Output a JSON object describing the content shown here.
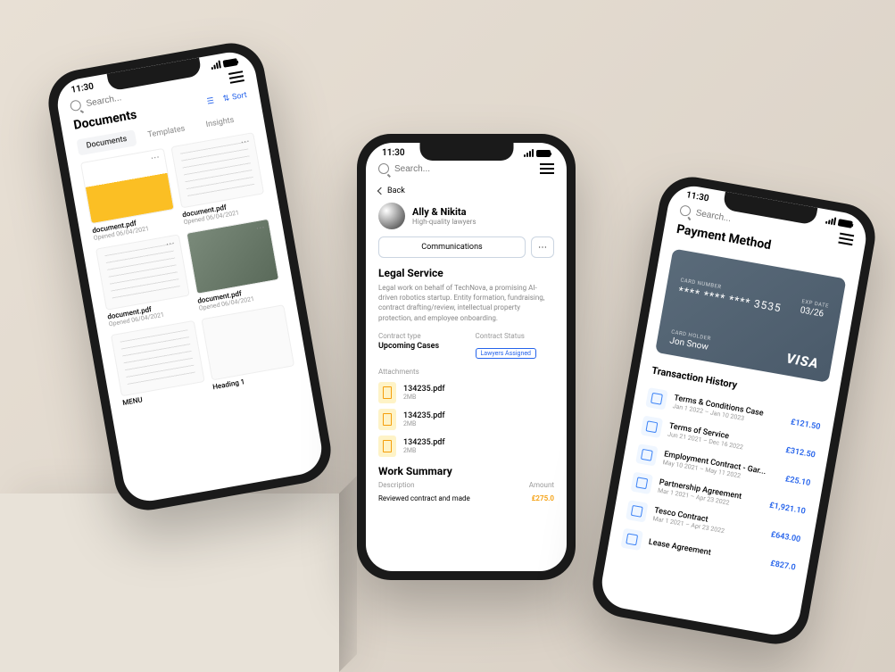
{
  "status": {
    "time": "11:30"
  },
  "search": {
    "placeholder": "Search..."
  },
  "documents": {
    "title": "Documents",
    "sort_label": "Sort",
    "tabs": [
      {
        "label": "Documents"
      },
      {
        "label": "Templates"
      },
      {
        "label": "Insights"
      }
    ],
    "items": [
      {
        "name": "document.pdf",
        "meta": "Opened 06/04/2021"
      },
      {
        "name": "document.pdf",
        "meta": "Opened 06/04/2021"
      },
      {
        "name": "document.pdf",
        "meta": "Opened 06/04/2021"
      },
      {
        "name": "document.pdf",
        "meta": "Opened 06/04/2021"
      },
      {
        "name": "MENU",
        "meta": ""
      },
      {
        "name": "Heading 1",
        "meta": ""
      }
    ]
  },
  "legal": {
    "back": "Back",
    "profile_name": "Ally & Nikita",
    "profile_sub": "High-quality lawyers",
    "comm_btn": "Communications",
    "section_title": "Legal Service",
    "desc": "Legal work on behalf of TechNova, a promising AI-driven robotics startup. Entity formation, fundraising, contract drafting/review, intellectual property protection, and employee onboarding.",
    "contract_type_label": "Contract type",
    "contract_type": "Upcoming Cases",
    "contract_status_label": "Contract Status",
    "contract_status": "Lawyers Assigned",
    "attachments_label": "Attachments",
    "attachments": [
      {
        "name": "134235.pdf",
        "size": "2MB"
      },
      {
        "name": "134235.pdf",
        "size": "2MB"
      },
      {
        "name": "134235.pdf",
        "size": "2MB"
      }
    ],
    "summary_title": "Work Summary",
    "summary_desc": "Description",
    "summary_amt": "Amount",
    "summary_row_desc": "Reviewed contract and made",
    "summary_row_amt": "£275.0"
  },
  "payment": {
    "title": "Payment Method",
    "card_number_label": "CARD NUMBER",
    "card_number": "**** **** **** 3535",
    "exp_label": "EXP DATE",
    "exp": "03/26",
    "holder_label": "CARD HOLDER",
    "holder": "Jon Snow",
    "brand": "VISA",
    "tx_title": "Transaction History",
    "tx": [
      {
        "name": "Terms & Conditions Case",
        "date": "Jan 1 2022 – Jan 10 2023",
        "amount": "£121.50"
      },
      {
        "name": "Terms of Service",
        "date": "Jun 21 2021 – Dec 16 2022",
        "amount": "£312.50"
      },
      {
        "name": "Employment Contract - Gar...",
        "date": "May 10 2021 – May 11 2022",
        "amount": "£25.10"
      },
      {
        "name": "Partnership Agreement",
        "date": "Mar 1 2021 – Apr 23 2022",
        "amount": "£1,921.10"
      },
      {
        "name": "Tesco Contract",
        "date": "Mar 1 2021 – Apr 23 2022",
        "amount": "£643.00"
      },
      {
        "name": "Lease Agreement",
        "date": "",
        "amount": "£827.0"
      }
    ]
  }
}
